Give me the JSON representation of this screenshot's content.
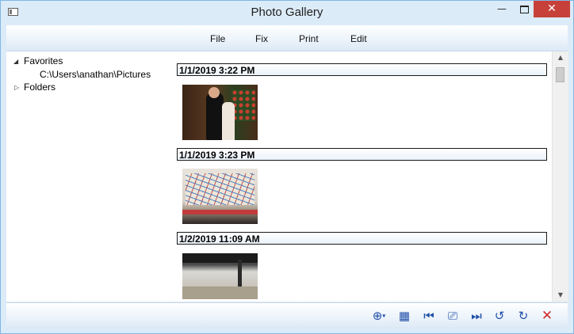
{
  "window": {
    "title": "Photo Gallery",
    "minimize_glyph": "—",
    "close_glyph": "✕"
  },
  "menu": {
    "items": [
      "File",
      "Fix",
      "Print",
      "Edit"
    ]
  },
  "tree": {
    "items": [
      {
        "label": "Favorites",
        "expanded": true,
        "arrow": "◢"
      },
      {
        "label": "C:\\Users\\anathan\\Pictures"
      },
      {
        "label": "Folders",
        "expanded": false,
        "arrow": "▷"
      }
    ]
  },
  "gallery": {
    "groups": [
      {
        "date": "1/1/2019 3:22 PM",
        "photo": "wedding-photo"
      },
      {
        "date": "1/1/2019 3:23 PM",
        "photo": "map-photo"
      },
      {
        "date": "1/2/2019 11:09 AM",
        "photo": "outdoor-photo"
      }
    ]
  },
  "scrollbar": {
    "up_glyph": "▲",
    "down_glyph": "▼"
  },
  "toolbar": {
    "buttons": [
      {
        "name": "zoom-icon",
        "glyph": "⊕"
      },
      {
        "name": "grid-view-icon",
        "glyph": "▦"
      },
      {
        "name": "first-photo-icon",
        "glyph": "⏮"
      },
      {
        "name": "slideshow-icon",
        "glyph": "⎚"
      },
      {
        "name": "last-photo-icon",
        "glyph": "⏭"
      },
      {
        "name": "rotate-left-icon",
        "glyph": "↺"
      },
      {
        "name": "rotate-right-icon",
        "glyph": "↻"
      },
      {
        "name": "delete-icon",
        "glyph": "✕"
      }
    ],
    "zoom_caret": "▾"
  },
  "colors": {
    "window_chrome": "#dcebf8",
    "close_button": "#c7413a",
    "toolbar_icon": "#1f4fa8",
    "delete_icon": "#d22b2b"
  }
}
